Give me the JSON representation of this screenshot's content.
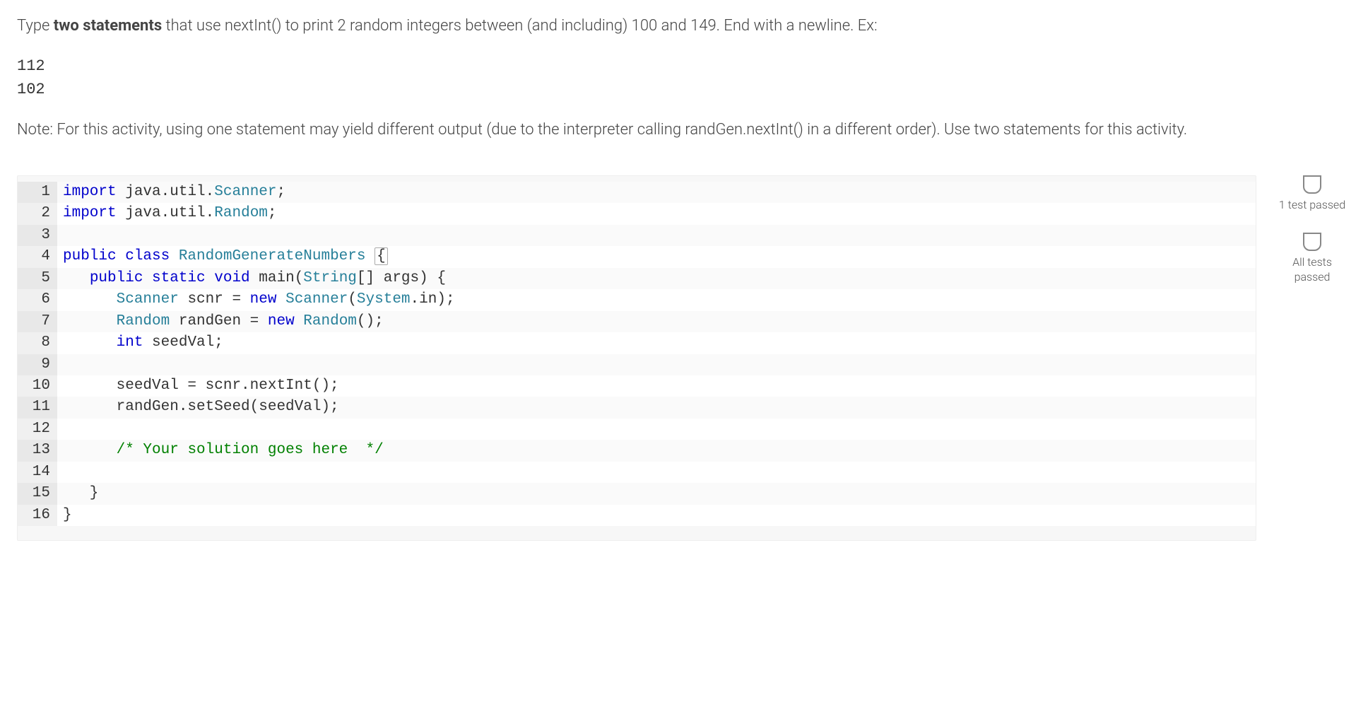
{
  "instructions": {
    "pre_bold": "Type ",
    "bold": "two statements",
    "post_bold": " that use nextInt() to print 2 random integers between (and including) 100 and 149. End with a newline. Ex:"
  },
  "example": "112\n102",
  "note": "Note: For this activity, using one statement may yield different output (due to the interpreter calling randGen.nextInt() in a different order). Use two statements for this activity.",
  "status": {
    "one_test": "1 test\npassed",
    "all_tests": "All tests\npassed"
  },
  "code": {
    "lines": [
      {
        "n": 1,
        "tokens": [
          {
            "t": "import ",
            "c": "k"
          },
          {
            "t": "java",
            "c": "p"
          },
          {
            "t": ".",
            "c": "p"
          },
          {
            "t": "util",
            "c": "p"
          },
          {
            "t": ".",
            "c": "p"
          },
          {
            "t": "Scanner",
            "c": "t"
          },
          {
            "t": ";",
            "c": "p"
          }
        ]
      },
      {
        "n": 2,
        "tokens": [
          {
            "t": "import ",
            "c": "k"
          },
          {
            "t": "java",
            "c": "p"
          },
          {
            "t": ".",
            "c": "p"
          },
          {
            "t": "util",
            "c": "p"
          },
          {
            "t": ".",
            "c": "p"
          },
          {
            "t": "Random",
            "c": "t"
          },
          {
            "t": ";",
            "c": "p"
          }
        ]
      },
      {
        "n": 3,
        "tokens": []
      },
      {
        "n": 4,
        "tokens": [
          {
            "t": "public class ",
            "c": "k"
          },
          {
            "t": "RandomGenerateNumbers ",
            "c": "t"
          },
          {
            "t": "{",
            "c": "p",
            "hl": true
          }
        ]
      },
      {
        "n": 5,
        "tokens": [
          {
            "t": "   ",
            "c": "p"
          },
          {
            "t": "public static void ",
            "c": "k"
          },
          {
            "t": "main",
            "c": "p"
          },
          {
            "t": "(",
            "c": "p"
          },
          {
            "t": "String",
            "c": "t"
          },
          {
            "t": "[] args) {",
            "c": "p"
          }
        ]
      },
      {
        "n": 6,
        "tokens": [
          {
            "t": "      ",
            "c": "p"
          },
          {
            "t": "Scanner ",
            "c": "t"
          },
          {
            "t": "scnr = ",
            "c": "p"
          },
          {
            "t": "new ",
            "c": "k"
          },
          {
            "t": "Scanner",
            "c": "t"
          },
          {
            "t": "(",
            "c": "p"
          },
          {
            "t": "System",
            "c": "t"
          },
          {
            "t": ".in);",
            "c": "p"
          }
        ]
      },
      {
        "n": 7,
        "tokens": [
          {
            "t": "      ",
            "c": "p"
          },
          {
            "t": "Random ",
            "c": "t"
          },
          {
            "t": "randGen = ",
            "c": "p"
          },
          {
            "t": "new ",
            "c": "k"
          },
          {
            "t": "Random",
            "c": "t"
          },
          {
            "t": "();",
            "c": "p"
          }
        ]
      },
      {
        "n": 8,
        "tokens": [
          {
            "t": "      ",
            "c": "p"
          },
          {
            "t": "int ",
            "c": "k"
          },
          {
            "t": "seedVal;",
            "c": "p"
          }
        ]
      },
      {
        "n": 9,
        "tokens": []
      },
      {
        "n": 10,
        "tokens": [
          {
            "t": "      seedVal = scnr.nextInt();",
            "c": "p"
          }
        ]
      },
      {
        "n": 11,
        "tokens": [
          {
            "t": "      randGen.setSeed(seedVal);",
            "c": "p"
          }
        ]
      },
      {
        "n": 12,
        "tokens": []
      },
      {
        "n": 13,
        "tokens": [
          {
            "t": "      ",
            "c": "p"
          },
          {
            "t": "/* Your solution goes here  */",
            "c": "c"
          }
        ]
      },
      {
        "n": 14,
        "tokens": []
      },
      {
        "n": 15,
        "tokens": [
          {
            "t": "   }",
            "c": "p"
          }
        ]
      },
      {
        "n": 16,
        "tokens": [
          {
            "t": "}",
            "c": "p"
          }
        ]
      }
    ]
  }
}
